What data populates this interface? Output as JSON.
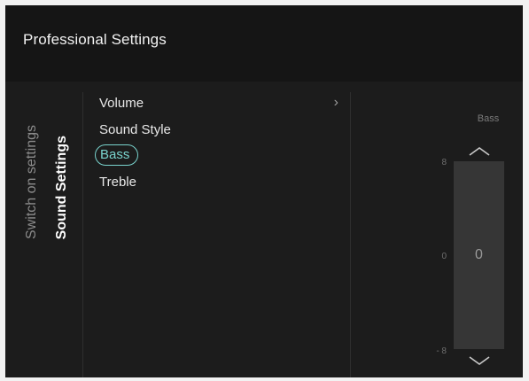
{
  "header": {
    "title": "Professional Settings"
  },
  "side_tabs": [
    {
      "label": "Switch on settings",
      "active": false
    },
    {
      "label": "Sound Settings",
      "active": true
    }
  ],
  "menu": {
    "items": [
      {
        "label": "Volume",
        "has_submenu": true
      },
      {
        "label": "Sound Style"
      },
      {
        "label": "Bass",
        "selected": true
      },
      {
        "label": "Treble"
      }
    ],
    "submenu_icon": "chevron-right-icon"
  },
  "slider": {
    "caption": "Bass",
    "value": "0",
    "max_label": "8",
    "mid_label": "0",
    "min_label": "- 8",
    "up_icon": "chevron-up-icon",
    "down_icon": "chevron-down-icon"
  },
  "colors": {
    "background": "#1c1c1c",
    "header": "#151515",
    "accent": "#79d3cd",
    "slider_track": "#363636"
  }
}
